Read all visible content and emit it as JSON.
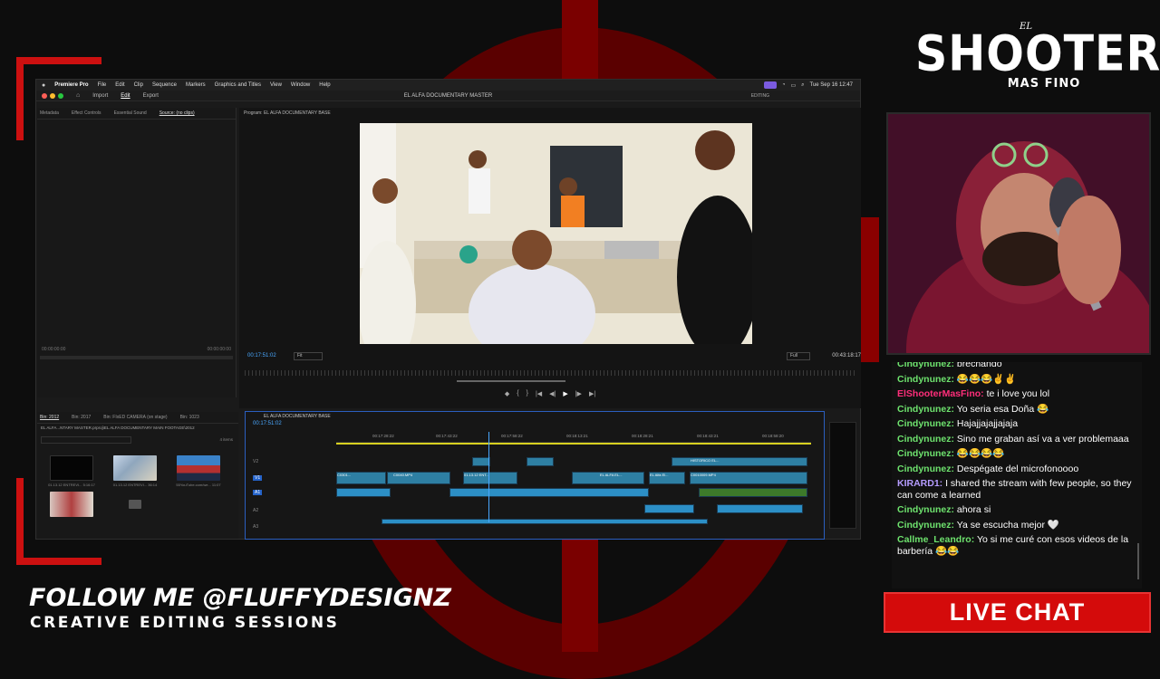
{
  "mac_menu": {
    "app": "Premiere Pro",
    "items": [
      "File",
      "Edit",
      "Clip",
      "Sequence",
      "Markers",
      "Graphics and Titles",
      "View",
      "Window",
      "Help"
    ],
    "clock": "Tue Sep 16  12:47"
  },
  "workspace": {
    "tabs": [
      "Import",
      "Edit",
      "Export"
    ],
    "active_tab": "Edit",
    "title": "EL ALFA DOCUMENTARY MASTER",
    "mode": "EDITING"
  },
  "source_panel": {
    "tabs": [
      "Metadata",
      "Effect Controls",
      "Essential Sound",
      "Source: (no clips)"
    ],
    "tc_left": "00:00:00:00",
    "tc_right": "00:00:00:00"
  },
  "program": {
    "title": "Program: EL ALFA DOCUMENTARY BASE",
    "tc_current": "00:17:51:02",
    "fit": "Fit",
    "quality": "Full",
    "tc_duration": "00:43:18:17",
    "transport": [
      "◆",
      "{",
      "}",
      "|◀",
      "◀|",
      "▶",
      "|▶",
      "▶|"
    ]
  },
  "project": {
    "tabs": [
      "Bin: 2012",
      "Bin: 2017",
      "Bin: FIxED CAMERA (on stage)",
      "Bin: 1023"
    ],
    "path": "EL ALFA...NTARY MASTER.prproj\\EL ALFA DOCUMENTARY MAIN FOOTAGE\\2012",
    "count": "4 items",
    "clips": [
      {
        "name": "01.13.12 ENTREVI...",
        "dur": "5:16:17"
      },
      {
        "name": "01.13.12 ENTREVI...",
        "dur": "36:14"
      },
      {
        "name": "55YouTube.com/we...",
        "dur": "11:07"
      },
      {
        "name": "",
        "dur": ""
      },
      {
        "name": "",
        "dur": ""
      }
    ]
  },
  "timeline": {
    "title": "EL ALFA DOCUMENTARY BASE",
    "tc": "00:17:51:02",
    "ruler": [
      "00:17:28:22",
      "00:17:43:22",
      "00:17:58:22",
      "00:18:13:21",
      "00:18:28:21",
      "00:18:43:21",
      "00:18:58:20"
    ],
    "tracks": [
      "V2",
      "V1",
      "A1",
      "A2",
      "A3"
    ],
    "clip_labels": [
      "C0301...",
      "C0040.MP4",
      "01.13.12 ENT...",
      "EL ALFA EL...",
      "EL Alfa El...",
      "C0010009.MP4",
      "HISTORICO EL..."
    ]
  },
  "logo": {
    "el": "EL",
    "main": "SHOOTER",
    "sub": "MAS FINO"
  },
  "chat": [
    {
      "user": "Cindynunez:",
      "msg": "brechando",
      "color": "#6ee36e"
    },
    {
      "user": "Cindynunez:",
      "msg": "😂😂😂✌️✌️",
      "color": "#6ee36e"
    },
    {
      "user": "ElShooterMasFino:",
      "msg": "te i love you lol",
      "color": "#ff2e7a"
    },
    {
      "user": "Cindynunez:",
      "msg": "Yo seria esa Doña 😂",
      "color": "#6ee36e"
    },
    {
      "user": "Cindynunez:",
      "msg": "Hajajjajajjajaja",
      "color": "#6ee36e"
    },
    {
      "user": "Cindynunez:",
      "msg": "Sino me graban así va a ver problemaaa",
      "color": "#6ee36e"
    },
    {
      "user": "Cindynunez:",
      "msg": "😂😂😂😂",
      "color": "#6ee36e"
    },
    {
      "user": "Cindynunez:",
      "msg": "Despégate del microfonoooo",
      "color": "#6ee36e"
    },
    {
      "user": "KIRARD1:",
      "msg": "I shared the stream with few people, so they can come a learned",
      "color": "#b59cff"
    },
    {
      "user": "Cindynunez:",
      "msg": "ahora si",
      "color": "#6ee36e"
    },
    {
      "user": "Cindynunez:",
      "msg": "Ya se escucha mejor 🤍",
      "color": "#6ee36e"
    },
    {
      "user": "Callme_Leandro:",
      "msg": "Yo si me curé con esos videos de la barbería 😂😂",
      "color": "#6ee36e"
    }
  ],
  "live_chat_label": "LIVE CHAT",
  "follow": "FOLLOW ME @FLUFFYDESIGNZ",
  "creative": "CREATIVE EDITING SESSIONS",
  "colors": {
    "accent": "#d40b0b",
    "timeline_clip": "#2e7fa3",
    "premiere_blue": "#2563c9"
  }
}
